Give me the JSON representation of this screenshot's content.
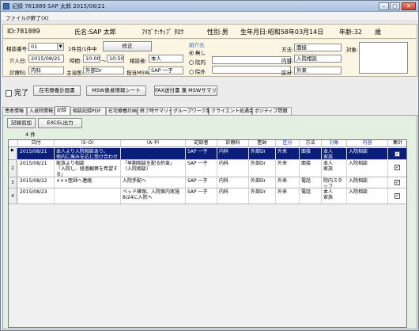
{
  "window": {
    "title": "記録 781889 SAP 太郎 2015/08/21",
    "minimize": "–",
    "maximize": "□",
    "close": "✕"
  },
  "menu": [
    "ファイル(F)",
    "終了(X)"
  ],
  "patient": {
    "id": "ID:781889",
    "name": "氏名:SAP 太郎",
    "kana": "ﾌﾘｶﾞﾅ:ｻｯﾌﾟ ﾀﾛｳ",
    "sex": "性別:男",
    "dob": "生年月日:昭和58年03月14日",
    "age": "年齢:32",
    "age_unit": "歳"
  },
  "consult": {
    "no_label": "相談番号:",
    "no_value": "01",
    "status_label": "1件目/1件中",
    "fix_button": "修正",
    "intro_date_label": "介入日:",
    "intro_date": "2015/08/21",
    "time_label": "時間:",
    "time_from": "10:00",
    "time_to": "10:50",
    "partner_label": "相談者:",
    "partner": "本人",
    "dept_label": "診療科:",
    "dept": "内科",
    "doctor_label": "主治医:",
    "doctor": "外部Dr",
    "msw_label": "担当MSW:",
    "msw": "SAP 一子",
    "intro_group": "紹介元",
    "radio_none": "無し",
    "radio_in": "院内",
    "radio_out": "院外",
    "method_label": "方法:",
    "method": "面接",
    "content_label": "内容:",
    "content": "入院相談",
    "category_label": "区分:",
    "category": "外来",
    "target_label": "対象:"
  },
  "actions": {
    "complete_label": "完了",
    "btn_plan": "在宅療養計画書",
    "btn_msw_sheet": "MSW患者情報シート",
    "btn_fax": "FAX送付書 兼 MSWサマリー"
  },
  "tabs": [
    "患者情報",
    "入退院情報",
    "記録",
    "相談記録PDF",
    "在宅療養計画",
    "終了時サマリー",
    "グループワーク業務",
    "クライエント処遇会議",
    "ポジティブ問題"
  ],
  "panel": {
    "add_button": "記録追加",
    "excel_button": "EXCEL出力",
    "count": "4 件"
  },
  "grid": {
    "headers": [
      "日付",
      "（S･O）",
      "（A･P）",
      "記録者",
      "診療科",
      "医師",
      "区分",
      "方法",
      "対象",
      "内容",
      "集計"
    ],
    "rows": [
      {
        "no": "1",
        "date": "2015/08/21",
        "so": "本人より入院相談あり。\n他内に高みを応じ受け合わせた。",
        "ap": "",
        "rec": "SAP 一子",
        "dept": "内科",
        "doc": "外部Dr",
        "cat": "外来",
        "method": "面接",
        "target": "本人\n家族",
        "content": "入院相談",
        "agg": "✓"
      },
      {
        "no": "2",
        "date": "2015/08/21",
        "so": "家族より相談\n「入院し、経過観察を希望する」",
        "ap": "「早期相談を配る約束」\n（入院相談）",
        "rec": "SAP 一子",
        "dept": "内科",
        "doc": "外部Dr",
        "cat": "外来",
        "method": "面接",
        "target": "本人\n家族",
        "content": "入院相談",
        "agg": "✓"
      },
      {
        "no": "3",
        "date": "2015/08/22",
        "so": "×××医師へ連絡",
        "ap": "入院手配へ",
        "rec": "SAP 一子",
        "dept": "内科",
        "doc": "外部Dr",
        "cat": "外来",
        "method": "電話",
        "target": "院内スタッフ",
        "content": "入院相談",
        "agg": "✓"
      },
      {
        "no": "4",
        "date": "2015/08/23",
        "so": "",
        "ap": "ベッド確保。入院案内実施\n8/24に入院へ",
        "rec": "SAP 一子",
        "dept": "内科",
        "doc": "外部Dr",
        "cat": "外来",
        "method": "電話",
        "target": "本人\n家族",
        "content": "入院相談",
        "agg": "✓"
      }
    ]
  },
  "colors": {
    "selected_row": "#0a1f7a",
    "panel_bg": "#e3efe0",
    "header_band": "#fbf6e4"
  }
}
